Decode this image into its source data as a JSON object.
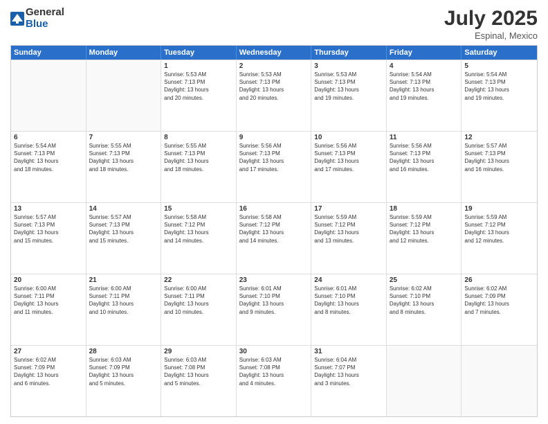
{
  "header": {
    "logo_general": "General",
    "logo_blue": "Blue",
    "month": "July 2025",
    "location": "Espinal, Mexico"
  },
  "weekdays": [
    "Sunday",
    "Monday",
    "Tuesday",
    "Wednesday",
    "Thursday",
    "Friday",
    "Saturday"
  ],
  "rows": [
    [
      {
        "day": "",
        "info": ""
      },
      {
        "day": "",
        "info": ""
      },
      {
        "day": "1",
        "info": "Sunrise: 5:53 AM\nSunset: 7:13 PM\nDaylight: 13 hours\nand 20 minutes."
      },
      {
        "day": "2",
        "info": "Sunrise: 5:53 AM\nSunset: 7:13 PM\nDaylight: 13 hours\nand 20 minutes."
      },
      {
        "day": "3",
        "info": "Sunrise: 5:53 AM\nSunset: 7:13 PM\nDaylight: 13 hours\nand 19 minutes."
      },
      {
        "day": "4",
        "info": "Sunrise: 5:54 AM\nSunset: 7:13 PM\nDaylight: 13 hours\nand 19 minutes."
      },
      {
        "day": "5",
        "info": "Sunrise: 5:54 AM\nSunset: 7:13 PM\nDaylight: 13 hours\nand 19 minutes."
      }
    ],
    [
      {
        "day": "6",
        "info": "Sunrise: 5:54 AM\nSunset: 7:13 PM\nDaylight: 13 hours\nand 18 minutes."
      },
      {
        "day": "7",
        "info": "Sunrise: 5:55 AM\nSunset: 7:13 PM\nDaylight: 13 hours\nand 18 minutes."
      },
      {
        "day": "8",
        "info": "Sunrise: 5:55 AM\nSunset: 7:13 PM\nDaylight: 13 hours\nand 18 minutes."
      },
      {
        "day": "9",
        "info": "Sunrise: 5:56 AM\nSunset: 7:13 PM\nDaylight: 13 hours\nand 17 minutes."
      },
      {
        "day": "10",
        "info": "Sunrise: 5:56 AM\nSunset: 7:13 PM\nDaylight: 13 hours\nand 17 minutes."
      },
      {
        "day": "11",
        "info": "Sunrise: 5:56 AM\nSunset: 7:13 PM\nDaylight: 13 hours\nand 16 minutes."
      },
      {
        "day": "12",
        "info": "Sunrise: 5:57 AM\nSunset: 7:13 PM\nDaylight: 13 hours\nand 16 minutes."
      }
    ],
    [
      {
        "day": "13",
        "info": "Sunrise: 5:57 AM\nSunset: 7:13 PM\nDaylight: 13 hours\nand 15 minutes."
      },
      {
        "day": "14",
        "info": "Sunrise: 5:57 AM\nSunset: 7:13 PM\nDaylight: 13 hours\nand 15 minutes."
      },
      {
        "day": "15",
        "info": "Sunrise: 5:58 AM\nSunset: 7:12 PM\nDaylight: 13 hours\nand 14 minutes."
      },
      {
        "day": "16",
        "info": "Sunrise: 5:58 AM\nSunset: 7:12 PM\nDaylight: 13 hours\nand 14 minutes."
      },
      {
        "day": "17",
        "info": "Sunrise: 5:59 AM\nSunset: 7:12 PM\nDaylight: 13 hours\nand 13 minutes."
      },
      {
        "day": "18",
        "info": "Sunrise: 5:59 AM\nSunset: 7:12 PM\nDaylight: 13 hours\nand 12 minutes."
      },
      {
        "day": "19",
        "info": "Sunrise: 5:59 AM\nSunset: 7:12 PM\nDaylight: 13 hours\nand 12 minutes."
      }
    ],
    [
      {
        "day": "20",
        "info": "Sunrise: 6:00 AM\nSunset: 7:11 PM\nDaylight: 13 hours\nand 11 minutes."
      },
      {
        "day": "21",
        "info": "Sunrise: 6:00 AM\nSunset: 7:11 PM\nDaylight: 13 hours\nand 10 minutes."
      },
      {
        "day": "22",
        "info": "Sunrise: 6:00 AM\nSunset: 7:11 PM\nDaylight: 13 hours\nand 10 minutes."
      },
      {
        "day": "23",
        "info": "Sunrise: 6:01 AM\nSunset: 7:10 PM\nDaylight: 13 hours\nand 9 minutes."
      },
      {
        "day": "24",
        "info": "Sunrise: 6:01 AM\nSunset: 7:10 PM\nDaylight: 13 hours\nand 8 minutes."
      },
      {
        "day": "25",
        "info": "Sunrise: 6:02 AM\nSunset: 7:10 PM\nDaylight: 13 hours\nand 8 minutes."
      },
      {
        "day": "26",
        "info": "Sunrise: 6:02 AM\nSunset: 7:09 PM\nDaylight: 13 hours\nand 7 minutes."
      }
    ],
    [
      {
        "day": "27",
        "info": "Sunrise: 6:02 AM\nSunset: 7:09 PM\nDaylight: 13 hours\nand 6 minutes."
      },
      {
        "day": "28",
        "info": "Sunrise: 6:03 AM\nSunset: 7:09 PM\nDaylight: 13 hours\nand 5 minutes."
      },
      {
        "day": "29",
        "info": "Sunrise: 6:03 AM\nSunset: 7:08 PM\nDaylight: 13 hours\nand 5 minutes."
      },
      {
        "day": "30",
        "info": "Sunrise: 6:03 AM\nSunset: 7:08 PM\nDaylight: 13 hours\nand 4 minutes."
      },
      {
        "day": "31",
        "info": "Sunrise: 6:04 AM\nSunset: 7:07 PM\nDaylight: 13 hours\nand 3 minutes."
      },
      {
        "day": "",
        "info": ""
      },
      {
        "day": "",
        "info": ""
      }
    ]
  ]
}
